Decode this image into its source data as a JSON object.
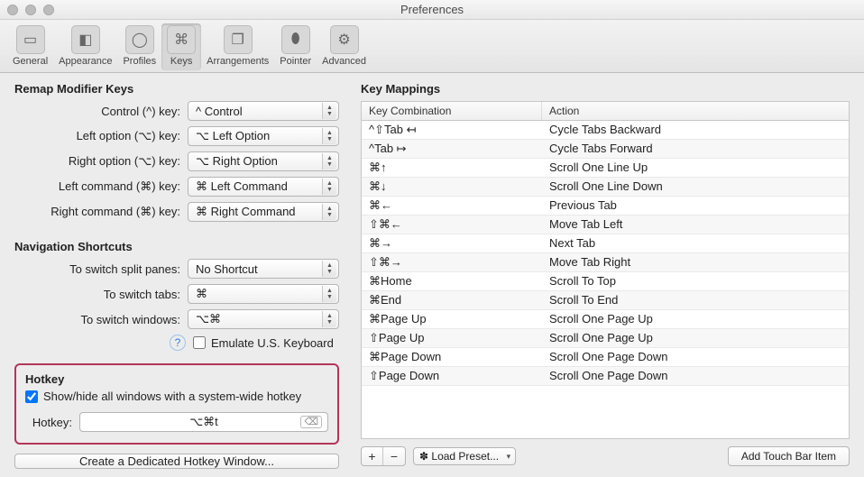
{
  "window": {
    "title": "Preferences"
  },
  "toolbar": {
    "items": [
      {
        "label": "General",
        "glyph": "▭"
      },
      {
        "label": "Appearance",
        "glyph": "◧"
      },
      {
        "label": "Profiles",
        "glyph": "◯"
      },
      {
        "label": "Keys",
        "glyph": "⌘"
      },
      {
        "label": "Arrangements",
        "glyph": "❐"
      },
      {
        "label": "Pointer",
        "glyph": "⬮"
      },
      {
        "label": "Advanced",
        "glyph": "⚙"
      }
    ],
    "selected_index": 3
  },
  "remap": {
    "title": "Remap Modifier Keys",
    "rows": [
      {
        "label": "Control (^) key:",
        "value": "^ Control"
      },
      {
        "label": "Left option (⌥) key:",
        "value": "⌥ Left Option"
      },
      {
        "label": "Right option (⌥) key:",
        "value": "⌥ Right Option"
      },
      {
        "label": "Left command (⌘) key:",
        "value": "⌘ Left Command"
      },
      {
        "label": "Right command (⌘) key:",
        "value": "⌘ Right Command"
      }
    ]
  },
  "nav": {
    "title": "Navigation Shortcuts",
    "rows": [
      {
        "label": "To switch split panes:",
        "value": "No Shortcut"
      },
      {
        "label": "To switch tabs:",
        "value": "⌘"
      },
      {
        "label": "To switch windows:",
        "value": "⌥⌘"
      }
    ],
    "emulate_label": "Emulate U.S. Keyboard",
    "emulate_checked": false
  },
  "hotkey": {
    "title": "Hotkey",
    "checkbox_label": "Show/hide all windows with a system-wide hotkey",
    "checked": true,
    "field_label": "Hotkey:",
    "value": "⌥⌘t"
  },
  "dedicated_button": "Create a Dedicated Hotkey Window...",
  "mappings": {
    "title": "Key Mappings",
    "col1": "Key Combination",
    "col2": "Action",
    "rows": [
      {
        "combo": "^⇧Tab ↤",
        "action": "Cycle Tabs Backward"
      },
      {
        "combo": "^Tab ↦",
        "action": "Cycle Tabs Forward"
      },
      {
        "combo": "⌘↑",
        "action": "Scroll One Line Up"
      },
      {
        "combo": "⌘↓",
        "action": "Scroll One Line Down"
      },
      {
        "combo": "⌘←",
        "action": "Previous Tab"
      },
      {
        "combo": "⇧⌘←",
        "action": "Move Tab Left"
      },
      {
        "combo": "⌘→",
        "action": "Next Tab"
      },
      {
        "combo": "⇧⌘→",
        "action": "Move Tab Right"
      },
      {
        "combo": "⌘Home",
        "action": "Scroll To Top"
      },
      {
        "combo": "⌘End",
        "action": "Scroll To End"
      },
      {
        "combo": "⌘Page Up",
        "action": "Scroll One Page Up"
      },
      {
        "combo": "⇧Page Up",
        "action": "Scroll One Page Up"
      },
      {
        "combo": "⌘Page Down",
        "action": "Scroll One Page Down"
      },
      {
        "combo": "⇧Page Down",
        "action": "Scroll One Page Down"
      }
    ]
  },
  "controls": {
    "load_preset": "✽ Load Preset...",
    "add_touch": "Add Touch Bar Item"
  }
}
